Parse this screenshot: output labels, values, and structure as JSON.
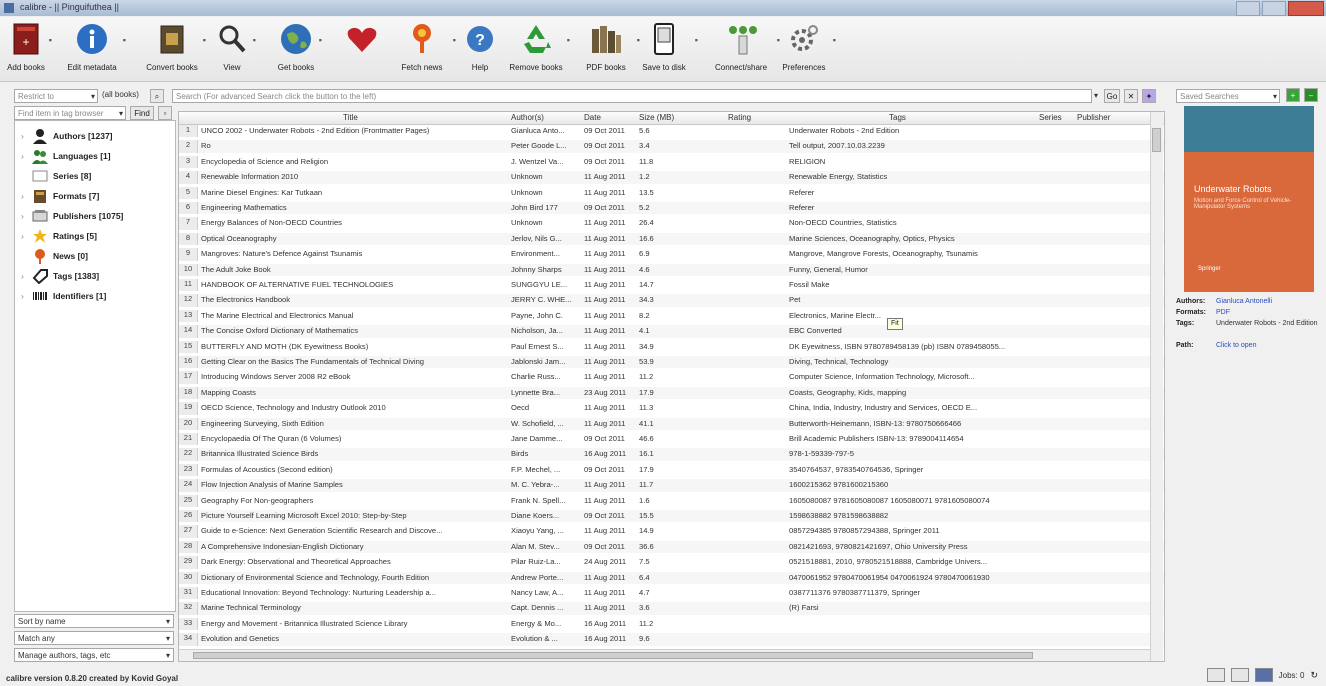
{
  "window": {
    "title": "calibre - || Pinguifuthea ||"
  },
  "toolbar": {
    "buttons": [
      {
        "label": "Add books",
        "icon": "add-book-icon"
      },
      {
        "label": "Edit metadata",
        "icon": "info-icon"
      },
      {
        "label": "Convert books",
        "icon": "convert-icon"
      },
      {
        "label": "View",
        "icon": "magnifier-icon"
      },
      {
        "label": "Get books",
        "icon": "globe-icon"
      },
      {
        "label": "",
        "icon": "heart-icon"
      },
      {
        "label": "Fetch news",
        "icon": "news-icon"
      },
      {
        "label": "Help",
        "icon": "help-icon"
      },
      {
        "label": "Remove books",
        "icon": "recycle-icon"
      },
      {
        "label": "PDF books",
        "icon": "library-icon"
      },
      {
        "label": "Save to disk",
        "icon": "device-icon"
      },
      {
        "label": "Connect/share",
        "icon": "connect-icon"
      },
      {
        "label": "Preferences",
        "icon": "gear-icon"
      }
    ]
  },
  "search": {
    "library_combo": "Restrict to",
    "all_books": "(all books)",
    "search_placeholder": "Search (For advanced Search click the button to the left)",
    "saved_searches": "Saved Searches",
    "find_placeholder": "Find item in tag browser",
    "find_button": "Find"
  },
  "tag_browser": {
    "items": [
      {
        "label": "Authors [1237]",
        "icon": "person-icon"
      },
      {
        "label": "Languages [1]",
        "icon": "languages-icon"
      },
      {
        "label": "Series [8]",
        "icon": "series-icon"
      },
      {
        "label": "Formats [7]",
        "icon": "formats-icon"
      },
      {
        "label": "Publishers [1075]",
        "icon": "publisher-icon"
      },
      {
        "label": "Ratings [5]",
        "icon": "star-icon"
      },
      {
        "label": "News [0]",
        "icon": "news-icon"
      },
      {
        "label": "Tags [1383]",
        "icon": "tag-icon"
      },
      {
        "label": "Identifiers [1]",
        "icon": "barcode-icon"
      }
    ],
    "sort_by": "Sort by name",
    "match": "Match any",
    "manage": "Manage authors, tags, etc"
  },
  "table": {
    "headers": [
      "Title",
      "Author(s)",
      "Date",
      "Size (MB)",
      "Rating",
      "Tags",
      "Series",
      "Publisher"
    ],
    "rows": [
      {
        "n": "1",
        "title": "UNCO 2002 - Underwater Robots - 2nd Edition (Frontmatter Pages)",
        "author": "Gianluca Anto...",
        "date": "09 Oct 2011",
        "size": "5.6",
        "tags": "Underwater Robots - 2nd Edition"
      },
      {
        "n": "2",
        "title": "Ro",
        "author": "Peter Goode L...",
        "date": "09 Oct 2011",
        "size": "3.4",
        "tags": "Tell output, 2007.10.03.2239"
      },
      {
        "n": "3",
        "title": "Encyclopedia of Science and Religion",
        "author": "J. Wentzel Va...",
        "date": "09 Oct 2011",
        "size": "11.8",
        "tags": "RELIGION"
      },
      {
        "n": "4",
        "title": "Renewable Information 2010",
        "author": "Unknown",
        "date": "11 Aug 2011",
        "size": "1.2",
        "tags": "Renewable Energy, Statistics"
      },
      {
        "n": "5",
        "title": "Marine Diesel Engines: Kar Tutkaan",
        "author": "Unknown",
        "date": "11 Aug 2011",
        "size": "13.5",
        "tags": "Referer"
      },
      {
        "n": "6",
        "title": "Engineering Mathematics",
        "author": "John Bird 177",
        "date": "09 Oct 2011",
        "size": "5.2",
        "tags": "Referer"
      },
      {
        "n": "7",
        "title": "Energy Balances of Non-OECD Countries",
        "author": "Unknown",
        "date": "11 Aug 2011",
        "size": "26.4",
        "tags": "Non-OECD Countries, Statistics"
      },
      {
        "n": "8",
        "title": "Optical Oceanography",
        "author": "Jerlov, Nils G...",
        "date": "11 Aug 2011",
        "size": "16.6",
        "tags": "Marine Sciences, Oceanography, Optics, Physics"
      },
      {
        "n": "9",
        "title": "Mangroves: Nature's Defence Against Tsunamis",
        "author": "Environment...",
        "date": "11 Aug 2011",
        "size": "6.9",
        "tags": "Mangrove, Mangrove Forests, Oceanography, Tsunamis"
      },
      {
        "n": "10",
        "title": "The Adult Joke Book",
        "author": "Johnny Sharps",
        "date": "11 Aug 2011",
        "size": "4.6",
        "tags": "Funny, General, Humor"
      },
      {
        "n": "11",
        "title": "HANDBOOK OF ALTERNATIVE FUEL TECHNOLOGIES",
        "author": "SUNGGYU LE...",
        "date": "11 Aug 2011",
        "size": "14.7",
        "tags": "Fossil Make"
      },
      {
        "n": "12",
        "title": "The Electronics Handbook",
        "author": "JERRY C. WHE...",
        "date": "11 Aug 2011",
        "size": "34.3",
        "tags": "Pet"
      },
      {
        "n": "13",
        "title": "The Marine Electrical and Electronics Manual",
        "author": "Payne, John C.",
        "date": "11 Aug 2011",
        "size": "8.2",
        "tags": "Electronics, Marine Electr..."
      },
      {
        "n": "14",
        "title": "The Concise Oxford Dictionary of Mathematics",
        "author": "Nicholson, Ja...",
        "date": "11 Aug 2011",
        "size": "4.1",
        "tags": "EBC Converted"
      },
      {
        "n": "15",
        "title": "BUTTERFLY AND MOTH (DK Eyewitness Books)",
        "author": "Paul Ernest S...",
        "date": "11 Aug 2011",
        "size": "34.9",
        "tags": "DK Eyewitness, ISBN 9780789458139 (pb) ISBN 0789458055..."
      },
      {
        "n": "16",
        "title": "Getting Clear on the Basics The Fundamentals of Technical Diving",
        "author": "Jablonski Jam...",
        "date": "11 Aug 2011",
        "size": "53.9",
        "tags": "Diving, Technical, Technology"
      },
      {
        "n": "17",
        "title": "Introducing Windows Server 2008 R2 eBook",
        "author": "Charlie Russ...",
        "date": "11 Aug 2011",
        "size": "11.2",
        "tags": "Computer Science, Information Technology, Microsoft..."
      },
      {
        "n": "18",
        "title": "Mapping Coasts",
        "author": "Lynnette Bra...",
        "date": "23 Aug 2011",
        "size": "17.9",
        "tags": "Coasts, Geography, Kids, mapping"
      },
      {
        "n": "19",
        "title": "OECD Science, Technology and Industry Outlook 2010",
        "author": "Oecd",
        "date": "11 Aug 2011",
        "size": "11.3",
        "tags": "China, India, Industry, Industry and Services, OECD E..."
      },
      {
        "n": "20",
        "title": "Engineering Surveying, Sixth Edition",
        "author": "W. Schofield, ...",
        "date": "11 Aug 2011",
        "size": "41.1",
        "tags": "Butterworth-Heinemann, ISBN-13: 9780750666466"
      },
      {
        "n": "21",
        "title": "Encyclopaedia Of The Quran (6 Volumes)",
        "author": "Jane Damme...",
        "date": "09 Oct 2011",
        "size": "46.6",
        "tags": "Brill Academic Publishers ISBN-13: 9789004114654"
      },
      {
        "n": "22",
        "title": "Britannica Illustrated Science Birds",
        "author": "Birds",
        "date": "16 Aug 2011",
        "size": "16.1",
        "tags": "978-1-59339-797-5"
      },
      {
        "n": "23",
        "title": "Formulas of Acoustics (Second edition)",
        "author": "F.P. Mechel, ...",
        "date": "09 Oct 2011",
        "size": "17.9",
        "tags": "3540764537, 9783540764536, Springer"
      },
      {
        "n": "24",
        "title": "Flow Injection Analysis of Marine Samples",
        "author": "M. C. Yebra-...",
        "date": "11 Aug 2011",
        "size": "11.7",
        "tags": "1600215362 9781600215360"
      },
      {
        "n": "25",
        "title": "Geography For Non-geographers",
        "author": "Frank N. Spell...",
        "date": "11 Aug 2011",
        "size": "1.6",
        "tags": "1605080087 9781605080087 1605080071 9781605080074"
      },
      {
        "n": "26",
        "title": "Picture Yourself Learning Microsoft Excel 2010: Step-by-Step",
        "author": "Diane Koers...",
        "date": "09 Oct 2011",
        "size": "15.5",
        "tags": "1598638882 9781598638882"
      },
      {
        "n": "27",
        "title": "Guide to e-Science: Next Generation Scientific Research and Discove...",
        "author": "Xiaoyu Yang, ...",
        "date": "11 Aug 2011",
        "size": "14.9",
        "tags": "0857294385 9780857294388, Springer 2011"
      },
      {
        "n": "28",
        "title": "A Comprehensive Indonesian-English Dictionary",
        "author": "Alan M. Stev...",
        "date": "09 Oct 2011",
        "size": "36.6",
        "tags": "0821421693, 9780821421697, Ohio University Press"
      },
      {
        "n": "29",
        "title": "Dark Energy: Observational and Theoretical Approaches",
        "author": "Pilar Ruiz-La...",
        "date": "24 Aug 2011",
        "size": "7.5",
        "tags": "0521518881, 2010, 9780521518888, Cambridge Univers..."
      },
      {
        "n": "30",
        "title": "Dictionary of Environmental Science and Technology, Fourth Edition",
        "author": "Andrew Porte...",
        "date": "11 Aug 2011",
        "size": "6.4",
        "tags": "0470061952 9780470061954 0470061924 9780470061930"
      },
      {
        "n": "31",
        "title": "Educational Innovation: Beyond Technology: Nurturing Leadership a...",
        "author": "Nancy Law, A...",
        "date": "11 Aug 2011",
        "size": "4.7",
        "tags": "0387711376 9780387711379, Springer"
      },
      {
        "n": "32",
        "title": "Marine Technical Terminology",
        "author": "Capt. Dennis ...",
        "date": "11 Aug 2011",
        "size": "3.6",
        "tags": "(R) Farsi"
      },
      {
        "n": "33",
        "title": "Energy and Movement - Britannica Illustrated Science Library",
        "author": "Energy & Mo...",
        "date": "16 Aug 2011",
        "size": "11.2",
        "tags": ""
      },
      {
        "n": "34",
        "title": "Evolution and Genetics",
        "author": "Evolution & ...",
        "date": "16 Aug 2011",
        "size": "9.6",
        "tags": ""
      }
    ],
    "tooltip": "Fit"
  },
  "details": {
    "cover_title": "Underwater Robots",
    "cover_subtitle": "Motion and Force Control of Vehicle-Manipulator Systems",
    "cover_publisher": "Springer",
    "authors_label": "Authors:",
    "authors_value": "Gianluca Antonelli",
    "formats_label": "Formats:",
    "formats_value": "PDF",
    "tags_label": "Tags:",
    "tags_value": "Underwater Robots - 2nd Edition",
    "path_label": "Path:",
    "path_value": "Click to open"
  },
  "status": {
    "text": "calibre version 0.8.20 created by Kovid Goyal",
    "jobs": "Jobs: 0"
  },
  "colors": {
    "accent": "#2a4dbf",
    "cover": "#d9683a",
    "cover_band": "#3d7d95"
  }
}
